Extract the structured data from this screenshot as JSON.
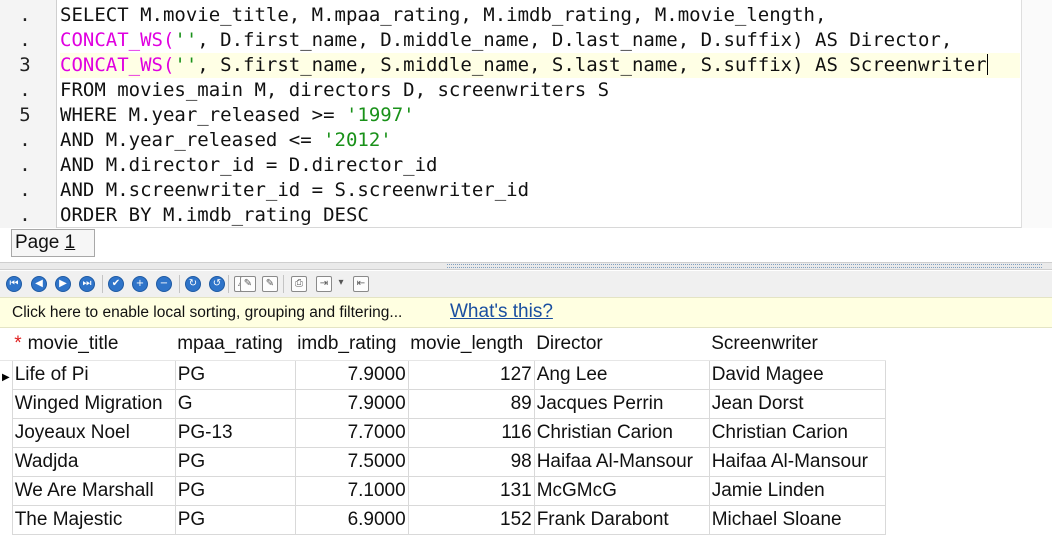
{
  "editor": {
    "gutter": [
      ".",
      ".",
      "3",
      ".",
      "5",
      ".",
      ".",
      ".",
      "."
    ],
    "lines": [
      [
        {
          "t": "SELECT",
          "c": "kw"
        },
        {
          "t": " M.movie_title, M.mpaa_rating, M.imdb_rating, M.movie_length,",
          "c": ""
        }
      ],
      [
        {
          "t": "CONCAT_WS(",
          "c": "fn"
        },
        {
          "t": "''",
          "c": "str"
        },
        {
          "t": ", D.first_name, D.middle_name, D.last_name, D.suffix) ",
          "c": ""
        },
        {
          "t": "AS",
          "c": "kw"
        },
        {
          "t": " Director,",
          "c": ""
        }
      ],
      [
        {
          "t": "CONCAT_WS(",
          "c": "fn"
        },
        {
          "t": "''",
          "c": "str"
        },
        {
          "t": ", S.first_name, S.middle_name, S.last_name, S.suffix) ",
          "c": ""
        },
        {
          "t": "AS",
          "c": "kw"
        },
        {
          "t": " Screenwriter",
          "c": ""
        }
      ],
      [
        {
          "t": "FROM",
          "c": "kw"
        },
        {
          "t": " movies_main M, directors D, screenwriters S",
          "c": ""
        }
      ],
      [
        {
          "t": "WHERE",
          "c": "kw"
        },
        {
          "t": " M.year_released >= ",
          "c": ""
        },
        {
          "t": "'1997'",
          "c": "str"
        }
      ],
      [
        {
          "t": "AND",
          "c": "kw"
        },
        {
          "t": " M.year_released <= ",
          "c": ""
        },
        {
          "t": "'2012'",
          "c": "str"
        }
      ],
      [
        {
          "t": "AND",
          "c": "kw"
        },
        {
          "t": " M.director_id = D.director_id",
          "c": ""
        }
      ],
      [
        {
          "t": "AND",
          "c": "kw"
        },
        {
          "t": " M.screenwriter_id = S.screenwriter_id",
          "c": ""
        }
      ],
      [
        {
          "t": "ORDER BY",
          "c": "kw"
        },
        {
          "t": " M.imdb_rating ",
          "c": ""
        },
        {
          "t": "DESC",
          "c": "kw"
        }
      ]
    ],
    "current_line": 2
  },
  "page_tab": {
    "prefix": "Page ",
    "number": "1"
  },
  "toolbar": {
    "icons": [
      {
        "name": "first-record-icon",
        "glyph": "⏮",
        "style": "circle"
      },
      {
        "name": "previous-record-icon",
        "glyph": "◀",
        "style": "circle"
      },
      {
        "name": "next-record-icon",
        "glyph": "▶",
        "style": "circle"
      },
      {
        "name": "last-record-icon",
        "glyph": "⏭",
        "style": "circle"
      },
      {
        "name": "post-record-icon",
        "glyph": "✔",
        "style": "circle"
      },
      {
        "name": "insert-record-icon",
        "glyph": "+",
        "style": "circle"
      },
      {
        "name": "delete-record-icon",
        "glyph": "−",
        "style": "circle"
      },
      {
        "name": "refresh-icon",
        "glyph": "↻",
        "style": "circle"
      },
      {
        "name": "cancel-edit-icon",
        "glyph": "↺",
        "style": "circle"
      },
      {
        "name": "warning-icon",
        "glyph": "⚠",
        "style": "square"
      },
      {
        "name": "edit-icon",
        "glyph": "✎",
        "style": "square"
      },
      {
        "name": "edit-active-icon",
        "glyph": "✎",
        "style": "square"
      },
      {
        "name": "print-icon",
        "glyph": "⎙",
        "style": "square"
      },
      {
        "name": "export-icon",
        "glyph": "⇥",
        "style": "square"
      },
      {
        "name": "export-dropdown-icon",
        "glyph": "▾",
        "style": "square"
      },
      {
        "name": "import-icon",
        "glyph": "⇤",
        "style": "square"
      }
    ]
  },
  "infobar": {
    "text": "Click here to enable local sorting, grouping and filtering...",
    "link": "What's this?"
  },
  "grid": {
    "key_marker": "*",
    "columns": [
      "movie_title",
      "mpaa_rating",
      "imdb_rating",
      "movie_length",
      "Director",
      "Screenwriter"
    ],
    "rows": [
      [
        "Life of Pi",
        "PG",
        "7.9000",
        "127",
        "Ang Lee",
        "David Magee"
      ],
      [
        "Winged Migration",
        "G",
        "7.9000",
        "89",
        "Jacques Perrin",
        "Jean Dorst"
      ],
      [
        "Joyeaux Noel",
        "PG-13",
        "7.7000",
        "116",
        "Christian Carion",
        "Christian Carion"
      ],
      [
        "Wadjda",
        "PG",
        "7.5000",
        "98",
        "Haifaa Al-Mansour",
        "Haifaa Al-Mansour"
      ],
      [
        "We Are Marshall",
        "PG",
        "7.1000",
        "131",
        "McGMcG",
        "Jamie Linden"
      ],
      [
        "The Majestic",
        "PG",
        "6.9000",
        "152",
        "Frank Darabont",
        "Michael Sloane"
      ]
    ],
    "numeric_columns": [
      2,
      3
    ],
    "current_row": 0
  }
}
